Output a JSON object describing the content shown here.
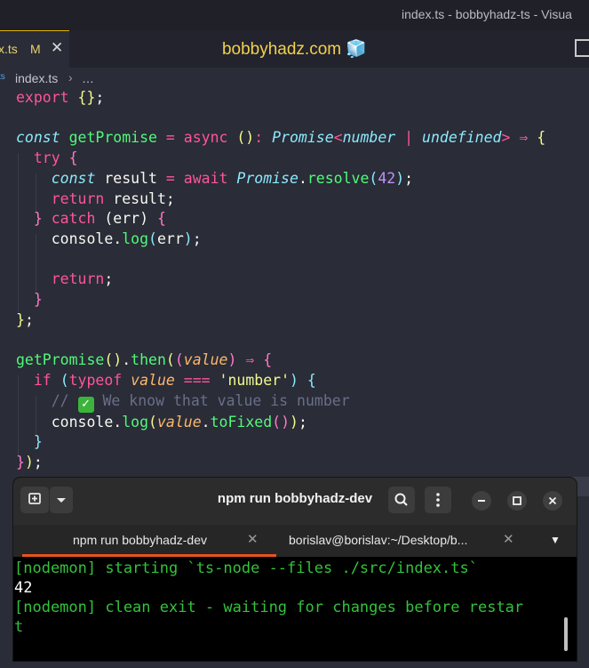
{
  "window": {
    "title": "index.ts - bobbyhadz-ts - Visua"
  },
  "editor_tab": {
    "name": "x.ts",
    "modified": "M",
    "close": "✕"
  },
  "center_title": "bobbyhadz.com 🧊",
  "breadcrumb": {
    "lang": "ts",
    "file": "index.ts",
    "sep": "›",
    "more": "…"
  },
  "code_tokens": {
    "export": "export",
    "const": "const",
    "getPromise": "getPromise",
    "async": "async",
    "Promise": "Promise",
    "number": "number",
    "undefined": "undefined",
    "arrow": "⇒",
    "try": "try",
    "result": "result",
    "await": "await",
    "resolve": "resolve",
    "n42": "42",
    "return": "return",
    "catch": "catch",
    "err": "err",
    "console": "console",
    "log": "log",
    "then": "then",
    "value": "value",
    "if": "if",
    "typeof": "typeof",
    "eqeq": "===",
    "number_str": "'number'",
    "comment_pre": "// ",
    "check": "✓",
    "comment_post": " We know that value is number",
    "toFixed": "toFixed"
  },
  "terminal": {
    "title": "npm run bobbyhadz-dev",
    "tabs": [
      {
        "label": "npm run bobbyhadz-dev",
        "active": true
      },
      {
        "label": "borislav@borislav:~/Desktop/b...",
        "active": false
      }
    ],
    "output": [
      "[nodemon] starting `ts-node --files ./src/index.ts`",
      "42",
      "[nodemon] clean exit - waiting for changes before restar",
      "t"
    ]
  },
  "icons": {
    "new_tab": "new-tab-icon",
    "dropdown": "chevron-down-icon",
    "search": "search-icon",
    "menu": "kebab-menu-icon",
    "minimize": "minimize-icon",
    "maximize": "maximize-icon",
    "close": "close-icon",
    "tab_close": "✕",
    "tabs_menu": "▼"
  },
  "colors": {
    "accent": "#e95420",
    "tab_border": "#e0b300",
    "output_green": "#33c23b"
  }
}
